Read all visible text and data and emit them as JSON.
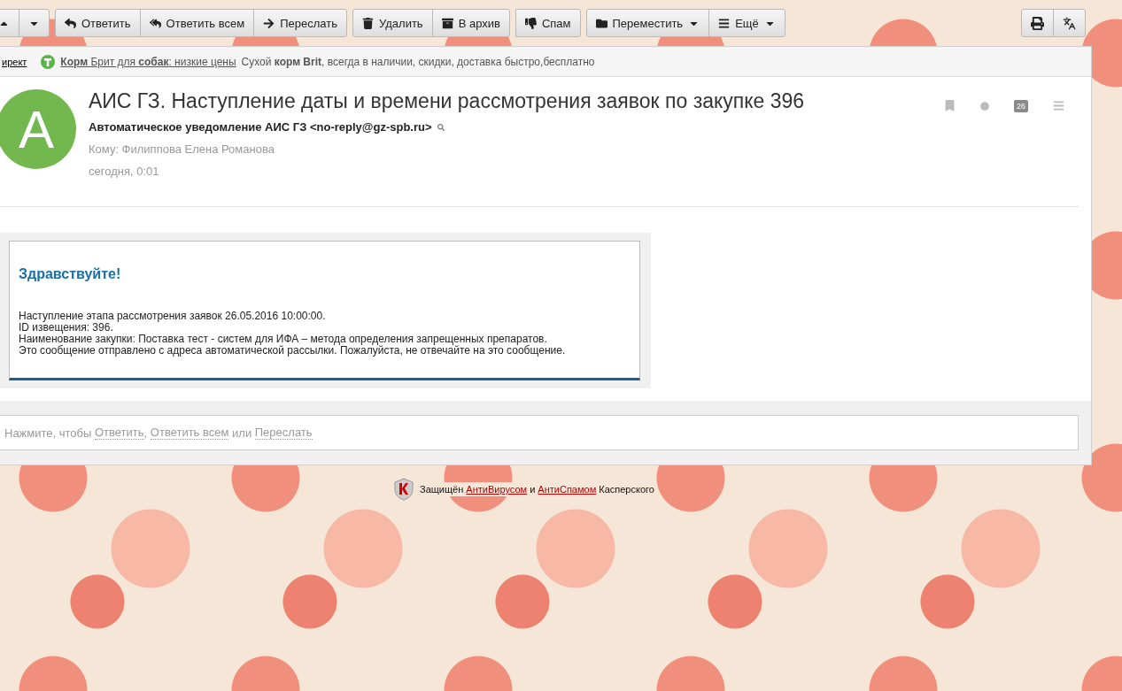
{
  "toolbar": {
    "groups": [
      [
        {
          "kind": "up"
        },
        {
          "kind": "down"
        }
      ],
      [
        {
          "kind": "reply",
          "label": "Ответить"
        },
        {
          "kind": "reply_all",
          "label": "Ответить всем"
        },
        {
          "kind": "forward",
          "label": "Переслать"
        }
      ],
      [
        {
          "kind": "delete",
          "label": "Удалить"
        },
        {
          "kind": "archive",
          "label": "В архив"
        }
      ],
      [
        {
          "kind": "spam",
          "label": "Спам"
        }
      ],
      [
        {
          "kind": "move",
          "label": "Переместить",
          "dropdown": true
        },
        {
          "kind": "more",
          "label": "Ещё",
          "dropdown": true
        }
      ]
    ],
    "right": [
      {
        "kind": "print"
      },
      {
        "kind": "translate"
      }
    ]
  },
  "ad": {
    "source": "ирект",
    "title": "**Корм** Брит для **собак**: низкие цены",
    "text": "Сухой **корм Brit**, всегда в наличии, скидки, доставка быстро,бесплатно"
  },
  "message": {
    "avatar_letter": "А",
    "subject": "АИС ГЗ. Наступление даты и времени рассмотрения заявок по закупке 396",
    "sender": "Автоматическое уведомление АИС ГЗ <no-reply@gz-spb.ru>",
    "to": "Кому: Филиппова Елена Романова",
    "date": "сегодня, 0:01",
    "calendar_day": "26",
    "body": {
      "greeting": "Здравствуйте!",
      "lines": [
        "Наступление этапа рассмотрения заявок 26.05.2016 10:00:00.",
        "ID извещения: 396.",
        "Наименование закупки: Поставка тест - систем для ИФА – метода определения запрещенных препаратов.",
        "Это сообщение отправлено с адреса автоматической рассылки. Пожалуйста, не отвечайте на это сообщение."
      ]
    }
  },
  "reply_prompt": [
    {
      "kind": "text",
      "text": "Нажмите, чтобы "
    },
    {
      "kind": "link",
      "text": "Ответить"
    },
    {
      "kind": "text",
      "text": ", "
    },
    {
      "kind": "link",
      "text": "Ответить всем"
    },
    {
      "kind": "text",
      "text": " или "
    },
    {
      "kind": "link",
      "text": "Переслать"
    }
  ],
  "protection": [
    {
      "kind": "text",
      "text": "Защищён "
    },
    {
      "kind": "link",
      "text": "АнтиВирусом"
    },
    {
      "kind": "text",
      "text": " и "
    },
    {
      "kind": "link",
      "text": "АнтиСпамом"
    },
    {
      "kind": "text",
      "text": " Касперского"
    }
  ]
}
